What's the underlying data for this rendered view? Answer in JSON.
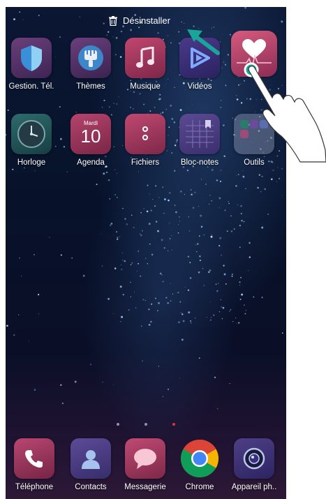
{
  "topbar": {
    "uninstall_label": "Désinstaller",
    "icon": "trash-icon"
  },
  "row1": [
    {
      "label": "Gestion. Tél.",
      "icon": "shield-icon"
    },
    {
      "label": "Thèmes",
      "icon": "paintbrush-icon"
    },
    {
      "label": "Musique",
      "icon": "music-note-icon"
    },
    {
      "label": "Vidéos",
      "icon": "play-icon"
    },
    {
      "label": "",
      "icon": "heart-pulse-icon"
    }
  ],
  "row2": [
    {
      "label": "Horloge",
      "icon": "clock-icon"
    },
    {
      "label": "Agenda",
      "icon": "calendar-icon",
      "day": "Mardi",
      "date": "10"
    },
    {
      "label": "Fichiers",
      "icon": "folder-icon"
    },
    {
      "label": "Bloc-notes",
      "icon": "notepad-icon"
    },
    {
      "label": "Outils",
      "icon": "tools-folder-icon"
    }
  ],
  "dock": [
    {
      "label": "Téléphone",
      "icon": "phone-icon"
    },
    {
      "label": "Contacts",
      "icon": "contact-icon"
    },
    {
      "label": "Messagerie",
      "icon": "message-bubble-icon"
    },
    {
      "label": "Chrome",
      "icon": "chrome-icon"
    },
    {
      "label": "Appareil ph..",
      "icon": "camera-icon"
    }
  ],
  "page_indicator": {
    "pages": 3,
    "active": 3
  },
  "colors": {
    "active_dot": "#e8303a",
    "drag_arrow": "#1aa59a",
    "touch_point": "#1aa59a"
  }
}
